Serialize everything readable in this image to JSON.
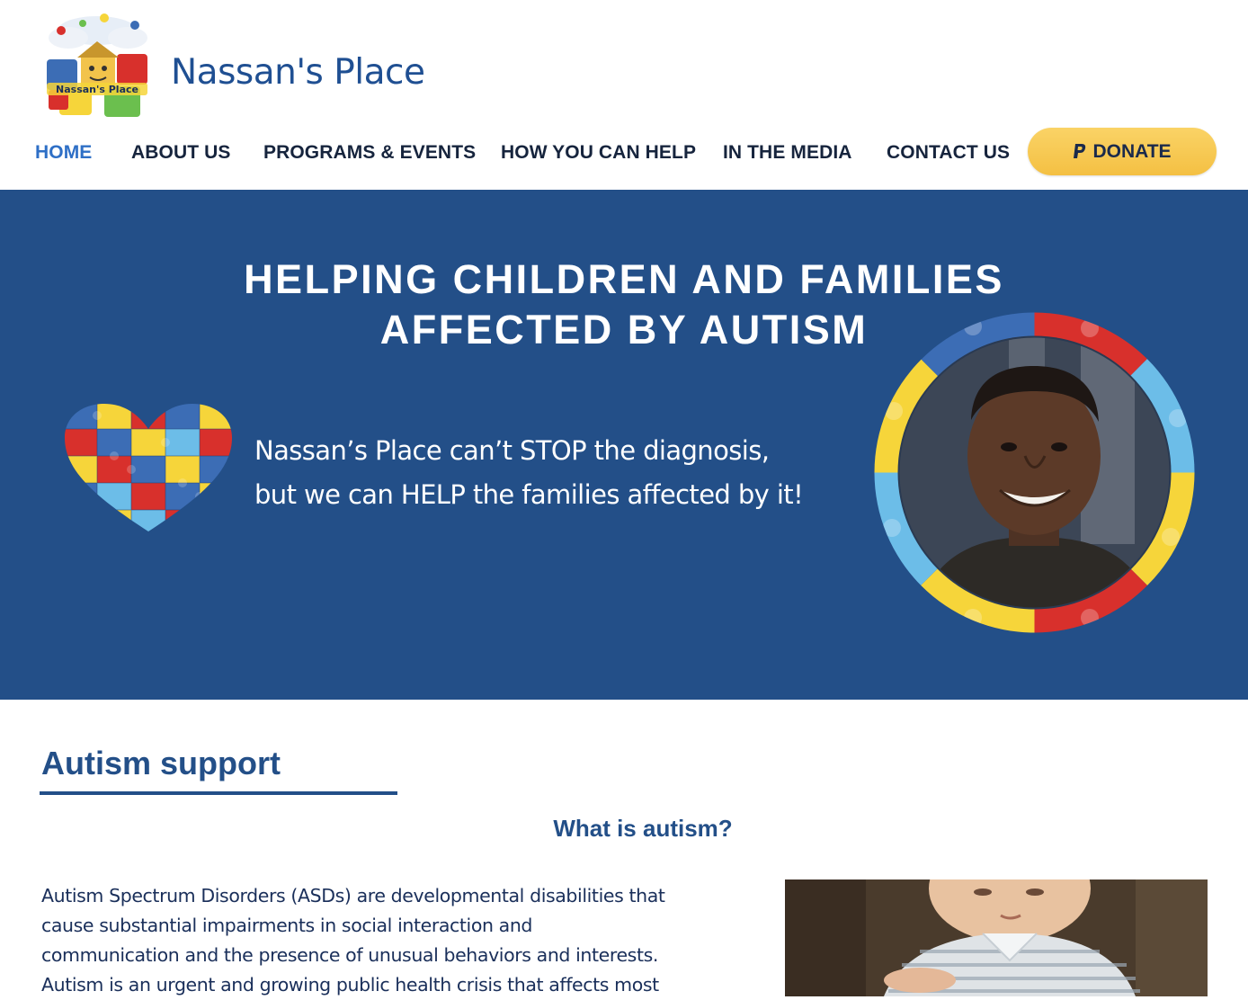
{
  "header": {
    "site_title": "Nassan's Place",
    "logo_text": "Nassan's Place",
    "nav": [
      {
        "label": "HOME",
        "active": true
      },
      {
        "label": "ABOUT US"
      },
      {
        "label": "PROGRAMS & EVENTS"
      },
      {
        "label": "HOW YOU CAN HELP"
      },
      {
        "label": "IN THE MEDIA"
      },
      {
        "label": "CONTACT US"
      }
    ],
    "donate": {
      "label": "DONATE",
      "icon": "paypal-icon"
    }
  },
  "hero": {
    "title_line1": "HELPING CHILDREN AND FAMILIES",
    "title_line2": "AFFECTED BY AUTISM",
    "text_line1": "Nassan’s Place can’t STOP the diagnosis,",
    "text_line2": "but we can HELP the families affected by it!"
  },
  "content": {
    "section_title": "Autism support",
    "sub_title": "What is autism?",
    "paragraph_lines": [
      "Autism Spectrum Disorders (ASDs) are developmental disabilities that",
      "cause substantial impairments in social interaction and",
      "communication and the presence of unusual behaviors and interests.",
      "Autism is an urgent and growing public health crisis that affects most"
    ]
  },
  "colors": {
    "brand_blue": "#234f88",
    "nav_active": "#2e6fc6",
    "donate_yellow": "#f4c043",
    "puzzle_red": "#d8302c",
    "puzzle_yellow": "#f6d53a",
    "puzzle_blue": "#3c6db5",
    "puzzle_light_blue": "#6cbde8"
  }
}
